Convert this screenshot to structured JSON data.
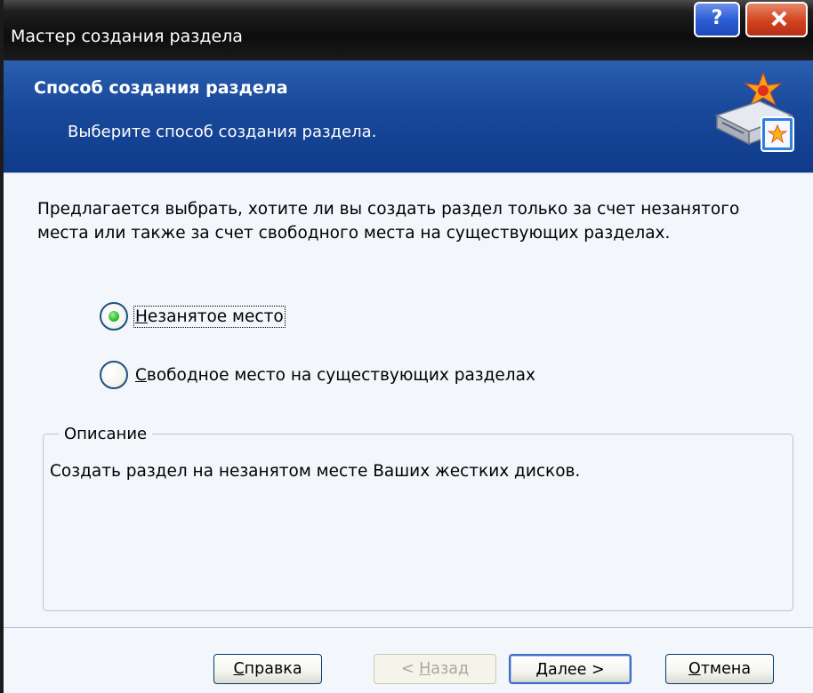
{
  "window": {
    "title": "Мастер создания раздела",
    "help_glyph": "?"
  },
  "header": {
    "title": "Способ создания раздела",
    "subtitle": "Выберите способ создания раздела.",
    "icon": "disk-wizard-icon"
  },
  "intro_text": "Предлагается выбрать, хотите ли вы создать раздел только за счет незанятого места или также за счет свободного места на существующих разделах.",
  "options": [
    {
      "label_first": "Н",
      "label_rest": "езанятое место",
      "checked": true
    },
    {
      "label_first": "С",
      "label_rest": "вободное место на существующих разделах",
      "checked": false
    }
  ],
  "description": {
    "legend": "Описание",
    "text": "Создать раздел на незанятом месте Ваших жестких дисков."
  },
  "buttons": {
    "help": {
      "prefix": "",
      "acc": "С",
      "rest": "правка"
    },
    "back": {
      "prefix": "< ",
      "acc": "Н",
      "rest": "азад",
      "disabled": true
    },
    "next": {
      "prefix": "",
      "acc": "Д",
      "rest": "алее >"
    },
    "cancel": {
      "prefix": "",
      "acc": "О",
      "rest": "тмена"
    }
  },
  "colors": {
    "header_blue": "#1a4a9c",
    "radio_checked": "#34c234",
    "close_red": "#d2431d"
  }
}
